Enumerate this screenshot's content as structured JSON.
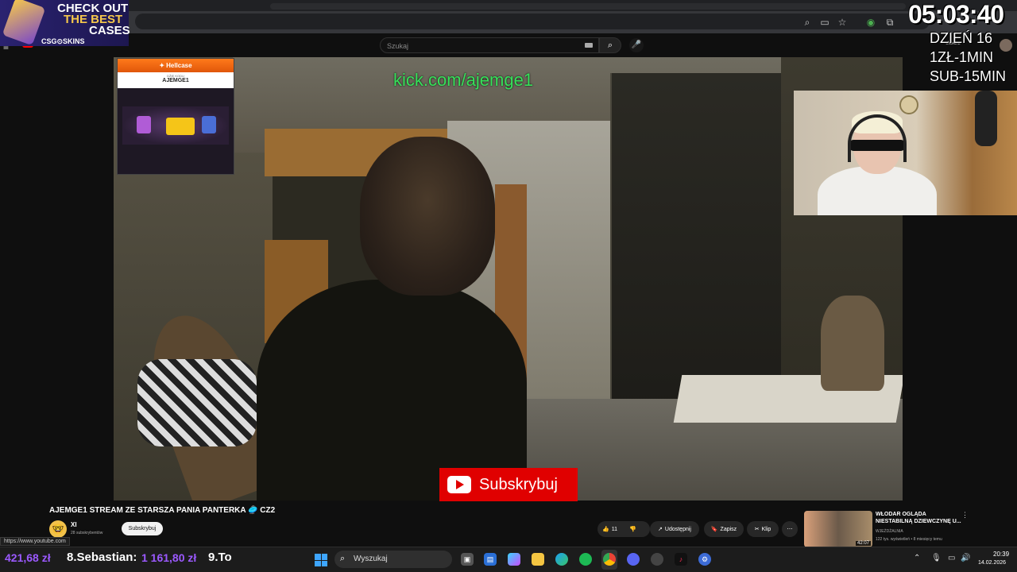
{
  "browser": {
    "tab_hint": ""
  },
  "youtube": {
    "logo": "YouTube",
    "search_placeholder": "Szukaj",
    "create_label": "Utwórz"
  },
  "overlays": {
    "csgo_banner": {
      "line1": "CHECK OUT",
      "line2": "THE BEST",
      "line3": "CASES",
      "brand": "CSG⊙SKINS"
    },
    "timer": {
      "clock": "05:03:40",
      "day": "DZIEŃ 16",
      "rate_zl": "1ZŁ-1MIN",
      "rate_sub": "SUB-15MIN"
    },
    "hellcase": {
      "brand": "Hellcase",
      "code_label": "DŽIĘ KODU",
      "code": "AJEMGE1"
    },
    "kick_url": "kick.com/ajemge1",
    "subscribe_overlay": "Subskrybuj"
  },
  "video_info": {
    "title": "AJEMGE1 STREAM ZE STARSZA PANIA PANTERKA 🥏 CZ2",
    "channel_name": "XI",
    "subscribers": "28 subskrybentów",
    "subscribe_label": "Subskrybuj",
    "likes": "11",
    "share_label": "Udostępnij",
    "save_label": "Zapisz",
    "clip_label": "Klip",
    "status_url": "https://www.youtube.com"
  },
  "recommendation": {
    "title": "WŁODAR OGLĄDA NIESTABILNĄ DZIEWCZYNĘ U...",
    "channel": "WJEŻDŻALNIA",
    "meta": "122 tys. wyświetleń • 8 miesięcy temu",
    "duration": "42:07"
  },
  "taskbar": {
    "money_left": "421,68 zł",
    "leader": "8.Sebastian:",
    "leader_amount": "1 161,80 zł",
    "next": "9.To",
    "search_label": "Wyszukaj",
    "time": "20:39",
    "date": "14.02.2026"
  }
}
